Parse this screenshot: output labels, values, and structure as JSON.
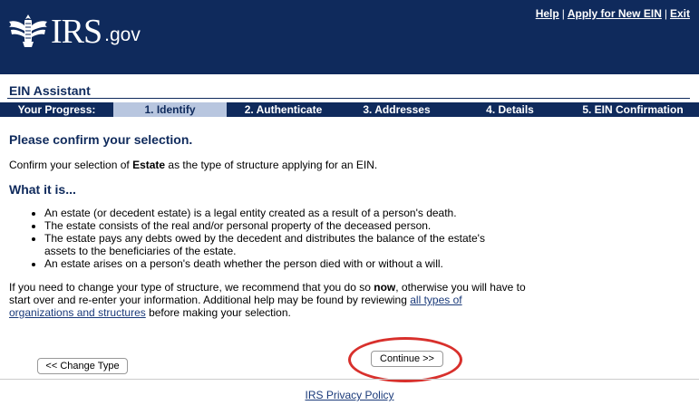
{
  "header": {
    "logo_irs": "IRS",
    "logo_gov": ".gov",
    "links": {
      "help": "Help",
      "apply": "Apply for New EIN",
      "exit": "Exit",
      "separator": "|"
    },
    "background": "#0f2a5c"
  },
  "assistant": {
    "title": "EIN Assistant"
  },
  "progress": {
    "label": "Your Progress:",
    "steps": [
      "1. Identify",
      "2. Authenticate",
      "3. Addresses",
      "4. Details",
      "5. EIN Confirmation"
    ],
    "active_step": 0,
    "active_color": "#b8c6df"
  },
  "content": {
    "heading": "Please confirm your selection.",
    "confirm_prefix": "Confirm your selection of ",
    "confirm_bold": "Estate",
    "confirm_suffix": " as the type of structure applying for an EIN.",
    "what_heading": "What it is...",
    "bullets": [
      "An estate (or decedent estate) is a legal entity created as a result of a person's death.",
      "The estate consists of the real and/or personal property of the deceased person.",
      "The estate pays any debts owed by the decedent and distributes the balance of the estate's assets to the beneficiaries of the estate.",
      "An estate arises on a person's death whether the person died with or without a will."
    ],
    "note_prefix": "If you need to change your type of structure, we recommend that you do so ",
    "note_bold": "now",
    "note_middle": ", otherwise you will have to start over and re-enter your information.  Additional help may be found by reviewing ",
    "note_link": "all types of organizations and structures",
    "note_suffix": " before making your selection."
  },
  "buttons": {
    "change_type": "<< Change Type",
    "continue": "Continue >>"
  },
  "footer": {
    "privacy": "IRS Privacy Policy"
  },
  "annotation": {
    "highlight_color": "#d8302c"
  }
}
